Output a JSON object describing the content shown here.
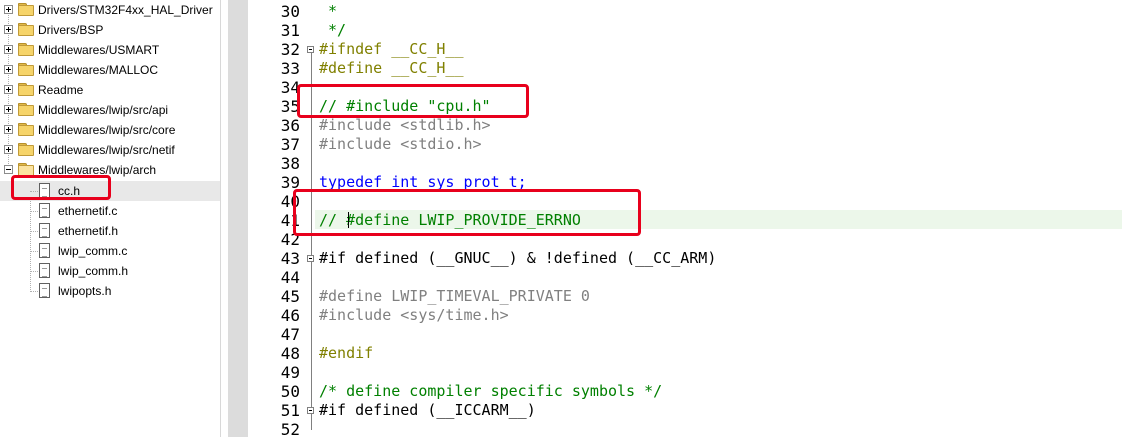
{
  "project_tree": {
    "items": [
      {
        "label": "Drivers/STM32F4xx_HAL_Driver",
        "kind": "folder",
        "expander": "plus"
      },
      {
        "label": "Drivers/BSP",
        "kind": "folder",
        "expander": "plus"
      },
      {
        "label": "Middlewares/USMART",
        "kind": "folder",
        "expander": "plus"
      },
      {
        "label": "Middlewares/MALLOC",
        "kind": "folder",
        "expander": "plus"
      },
      {
        "label": "Readme",
        "kind": "folder",
        "expander": "plus"
      },
      {
        "label": "Middlewares/lwip/src/api",
        "kind": "folder",
        "expander": "plus"
      },
      {
        "label": "Middlewares/lwip/src/core",
        "kind": "folder",
        "expander": "plus"
      },
      {
        "label": "Middlewares/lwip/src/netif",
        "kind": "folder",
        "expander": "plus"
      },
      {
        "label": "Middlewares/lwip/arch",
        "kind": "folder-open",
        "expander": "minus"
      },
      {
        "label": "cc.h",
        "kind": "file",
        "selected": true
      },
      {
        "label": "ethernetif.c",
        "kind": "file"
      },
      {
        "label": "ethernetif.h",
        "kind": "file"
      },
      {
        "label": "lwip_comm.c",
        "kind": "file"
      },
      {
        "label": "lwip_comm.h",
        "kind": "file"
      },
      {
        "label": "lwipopts.h",
        "kind": "file"
      }
    ]
  },
  "editor": {
    "lines": [
      {
        "num": "30",
        "text": " *"
      },
      {
        "num": "31",
        "text": " */"
      },
      {
        "num": "32",
        "text": "#ifndef __CC_H__"
      },
      {
        "num": "33",
        "text": "#define __CC_H__"
      },
      {
        "num": "34",
        "text": ""
      },
      {
        "num": "35",
        "text": "// #include \"cpu.h\""
      },
      {
        "num": "36",
        "text": "#include <stdlib.h>"
      },
      {
        "num": "37",
        "text": "#include <stdio.h>"
      },
      {
        "num": "38",
        "text": ""
      },
      {
        "num": "39",
        "text": "typedef int sys_prot_t;"
      },
      {
        "num": "40",
        "text": ""
      },
      {
        "num": "41",
        "text": "// #define LWIP_PROVIDE_ERRNO"
      },
      {
        "num": "42",
        "text": ""
      },
      {
        "num": "43",
        "text": "#if defined (__GNUC__) & !defined (__CC_ARM)"
      },
      {
        "num": "44",
        "text": ""
      },
      {
        "num": "45",
        "text": "#define LWIP_TIMEVAL_PRIVATE 0"
      },
      {
        "num": "46",
        "text": "#include <sys/time.h>"
      },
      {
        "num": "47",
        "text": ""
      },
      {
        "num": "48",
        "text": "#endif"
      },
      {
        "num": "49",
        "text": ""
      },
      {
        "num": "50",
        "text": "/* define compiler specific symbols */"
      },
      {
        "num": "51",
        "text": "#if defined (__ICCARM__)"
      },
      {
        "num": "52",
        "text": ""
      }
    ],
    "current_line": "41"
  },
  "colors": {
    "highlight_box": "#e8001c",
    "current_line_bg": "#ecf7ea",
    "preprocessor": "#808000",
    "comment": "#008000",
    "keyword": "#0000ff",
    "include_path": "#a000a0"
  }
}
